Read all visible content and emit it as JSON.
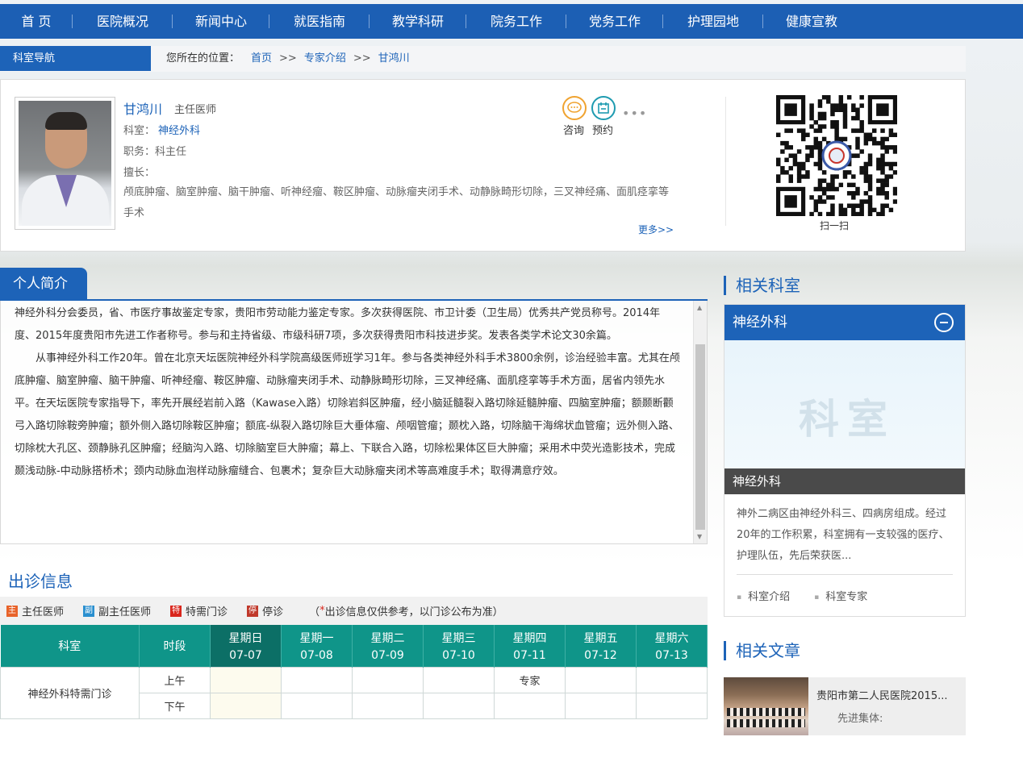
{
  "topnav": {
    "items": [
      "首 页",
      "医院概况",
      "新闻中心",
      "就医指南",
      "教学科研",
      "院务工作",
      "党务工作",
      "护理园地",
      "健康宣教"
    ]
  },
  "subnav": {
    "dept_nav_label": "科室导航",
    "location_label": "您所在的位置：",
    "crumbs": [
      "首页",
      "专家介绍",
      "甘鸿川"
    ],
    "sep": ">>"
  },
  "doctor": {
    "name": "甘鸿川",
    "title": "主任医师",
    "dept_label": "科室：",
    "dept": "神经外科",
    "duty": "职务：科主任",
    "skill_label": "擅长：",
    "skills": "颅底肿瘤、脑室肿瘤、脑干肿瘤、听神经瘤、鞍区肿瘤、动脉瘤夹闭手术、动静脉畸形切除，三叉神经痛、面肌痉挛等手术",
    "more": "更多>>",
    "actions": {
      "consult": "咨询",
      "appointment": "预约"
    },
    "qr_label": "扫一扫"
  },
  "bio": {
    "section_title": "个人简介",
    "paragraphs": [
      "神经外科分会委员，省、市医疗事故鉴定专家，贵阳市劳动能力鉴定专家。多次获得医院、市卫计委（卫生局）优秀共产党员称号。2014年度、2015年度贵阳市先进工作者称号。参与和主持省级、市级科研7项，多次获得贵阳市科技进步奖。发表各类学术论文30余篇。",
      "从事神经外科工作20年。曾在北京天坛医院神经外科学院高级医师班学习1年。参与各类神经外科手术3800余例，诊治经验丰富。尤其在颅底肿瘤、脑室肿瘤、脑干肿瘤、听神经瘤、鞍区肿瘤、动脉瘤夹闭手术、动静脉畸形切除，三叉神经痛、面肌痉挛等手术方面，居省内领先水平。在天坛医院专家指导下，率先开展经岩前入路（Kawase入路）切除岩斜区肿瘤，经小脑延髓裂入路切除延髓肿瘤、四脑室肿瘤；额颞断颧弓入路切除鞍旁肿瘤；额外侧入路切除鞍区肿瘤；额底-纵裂入路切除巨大垂体瘤、颅咽管瘤；颞枕入路，切除脑干海绵状血管瘤；远外侧入路、切除枕大孔区、颈静脉孔区肿瘤；经脑沟入路、切除脑室巨大肿瘤；幕上、下联合入路，切除松果体区巨大肿瘤；采用术中荧光造影技术，完成颞浅动脉-中动脉搭桥术；颈内动脉血泡样动脉瘤缝合、包裹术；复杂巨大动脉瘤夹闭术等高难度手术；取得满意疗效。"
    ]
  },
  "schedule": {
    "title": "出诊信息",
    "legend": [
      {
        "badge": "主",
        "label": "主任医师",
        "color": "#e8632a"
      },
      {
        "badge": "副",
        "label": "副主任医师",
        "color": "#2a8fcf"
      },
      {
        "badge": "特",
        "label": "特需门诊",
        "color": "#d9261c"
      },
      {
        "badge": "停",
        "label": "停诊",
        "color": "#c0392b"
      }
    ],
    "note_open": "（",
    "note_star": "*",
    "note_text": "出诊信息仅供参考，以门诊公布为准）",
    "headers": {
      "dept": "科室",
      "period": "时段"
    },
    "days": [
      {
        "weekday": "星期日",
        "date": "07-07"
      },
      {
        "weekday": "星期一",
        "date": "07-08"
      },
      {
        "weekday": "星期二",
        "date": "07-09"
      },
      {
        "weekday": "星期三",
        "date": "07-10"
      },
      {
        "weekday": "星期四",
        "date": "07-11"
      },
      {
        "weekday": "星期五",
        "date": "07-12"
      },
      {
        "weekday": "星期六",
        "date": "07-13"
      }
    ],
    "rows": [
      {
        "dept": "神经外科特需门诊",
        "period": "上午",
        "cells": [
          "",
          "",
          "",
          "",
          "专家",
          "",
          ""
        ]
      },
      {
        "period": "下午",
        "cells": [
          "",
          "",
          "",
          "",
          "",
          "",
          ""
        ]
      }
    ]
  },
  "sidebar": {
    "related_dept_title": "相关科室",
    "dept_name": "神经外科",
    "dept_image_text": "科室",
    "dept_caption": "神经外科",
    "dept_desc": "神外二病区由神经外科三、四病房组成。经过20年的工作积累，科室拥有一支较强的医疗、护理队伍，先后荣获医...",
    "dept_links": [
      "科室介绍",
      "科室专家"
    ],
    "related_article_title": "相关文章",
    "article": {
      "title": "贵阳市第二人民医院2015...",
      "subtitle": "先进集体:"
    }
  }
}
